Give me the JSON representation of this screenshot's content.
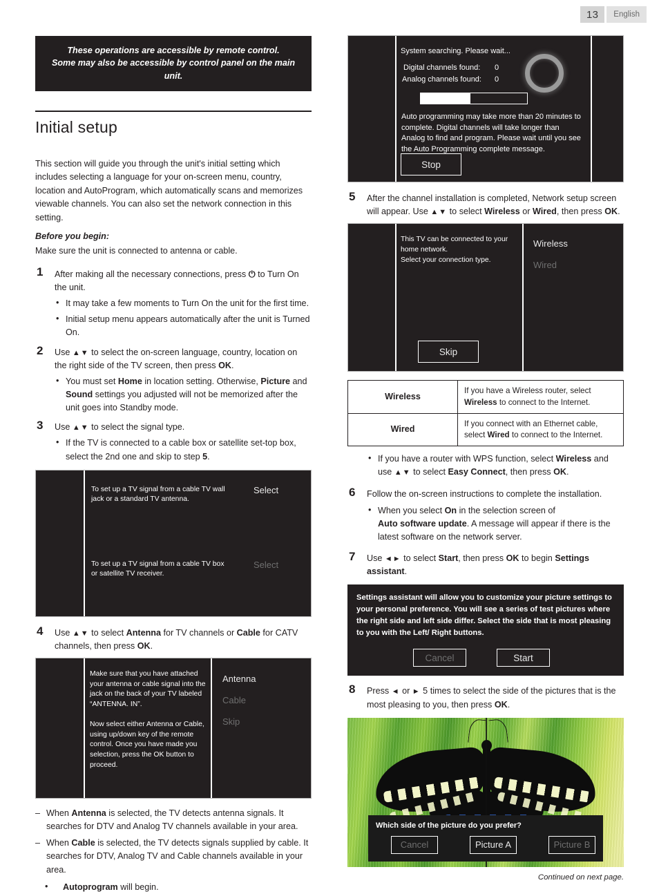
{
  "header": {
    "page_number": "13",
    "language": "English"
  },
  "notice": {
    "line1": "These operations are accessible by remote control.",
    "line2": "Some may also be accessible by control panel on the main unit."
  },
  "section": {
    "title": "Initial setup",
    "intro": "This section will guide you through the unit's initial setting which includes selecting a language for your on-screen menu, country, location and AutoProgram, which automatically scans and memorizes viewable channels. You can also set the network connection in this setting.",
    "before_label": "Before you begin:",
    "before_text": "Make sure the unit is connected to antenna or cable."
  },
  "steps": {
    "s1": {
      "num": "1",
      "text": "After making all the necessary connections, press ⏻ to Turn On the unit.",
      "b1": "It may take a few moments to Turn On the unit for the first time.",
      "b2": "Initial setup menu appears automatically after the unit is Turned On."
    },
    "s2": {
      "num": "2",
      "text": "Use ▲▼ to select the on-screen language, country, location on the right side of the TV screen, then press OK.",
      "b1": "You must set Home in location setting. Otherwise, Picture and Sound settings you adjusted will not be memorized after the unit goes into Standby mode."
    },
    "s3": {
      "num": "3",
      "text": "Use ▲▼ to select the signal type.",
      "b1": "If the TV is connected to a cable box or satellite set-top box, select the 2nd one and skip to step 5."
    },
    "s4": {
      "num": "4",
      "text": "Use ▲▼ to select Antenna for TV channels or Cable for CATV channels, then press OK.",
      "d1": "When Antenna is selected, the TV detects antenna signals. It searches for DTV and Analog TV channels available in your area.",
      "d2": "When Cable is selected, the TV detects signals supplied by cable. It searches for DTV, Analog TV and Cable channels available in your area.",
      "b1": "Autoprogram will begin."
    },
    "s5": {
      "num": "5",
      "text": "After the channel installation is completed, Network setup screen will appear. Use ▲▼ to select Wireless or Wired, then press OK.",
      "b1": "If you have a router with WPS function, select Wireless and use ▲▼ to select Easy Connect, then press OK."
    },
    "s6": {
      "num": "6",
      "text": "Follow the on-screen instructions to complete the installation.",
      "b1": "When you select On in the selection screen of Auto software update. A message will appear if there is the latest software on the network server."
    },
    "s7": {
      "num": "7",
      "text": "Use ◄► to select Start, then press OK to begin Settings assistant."
    },
    "s8": {
      "num": "8",
      "text": "Press ◄ or ► 5 times to select the side of the pictures that is the most pleasing to you, then press OK."
    }
  },
  "signal_screen": {
    "option1": "To set up a TV signal from a cable TV wall jack or a standard TV antenna.",
    "option1_action": "Select",
    "option2": "To set up a TV signal from a cable TV box or satellite TV receiver.",
    "option2_action": "Select"
  },
  "antenna_screen": {
    "para1": "Make sure that you have attached your antenna or cable signal into the jack on the back of your TV labeled “ANTENNA. IN”.",
    "para2": "Now select either Antenna or Cable, using up/down key of the remote control. Once you have made you selection, press the OK button to proceed.",
    "opt1": "Antenna",
    "opt2": "Cable",
    "opt3": "Skip"
  },
  "search_screen": {
    "title": "System searching. Please wait...",
    "digital_label": "Digital channels found:",
    "digital_value": "0",
    "analog_label": "Analog channels found:",
    "analog_value": "0",
    "progress_percent": 47,
    "note": "Auto programming may take more than 20 minutes to complete. Digital channels will take longer than Analog to find and program. Please wait until you see the Auto Programming complete message.",
    "stop_button": "Stop"
  },
  "network_screen": {
    "para": "This TV can be connected to your home network.\nSelect your connection type.",
    "opt1": "Wireless",
    "opt2": "Wired",
    "skip_button": "Skip"
  },
  "network_table": {
    "row1_key": "Wireless",
    "row1_desc": "If you have a Wireless router, select Wireless to connect to the Internet.",
    "row2_key": "Wired",
    "row2_desc": "If you connect with an Ethernet cable, select Wired to connect to the Internet."
  },
  "settings_assistant": {
    "text": "Settings assistant will allow you to customize your picture settings to your personal preference. You will see a series of test pictures where the right side and left side differ. Select the side that is most pleasing to you with the Left/ Right buttons.",
    "cancel_button": "Cancel",
    "start_button": "Start"
  },
  "picture_screen": {
    "question": "Which side of the picture do you prefer?",
    "cancel_button": "Cancel",
    "picture_a_button": "Picture A",
    "picture_b_button": "Picture B"
  },
  "footer": {
    "continued": "Continued on next page."
  }
}
